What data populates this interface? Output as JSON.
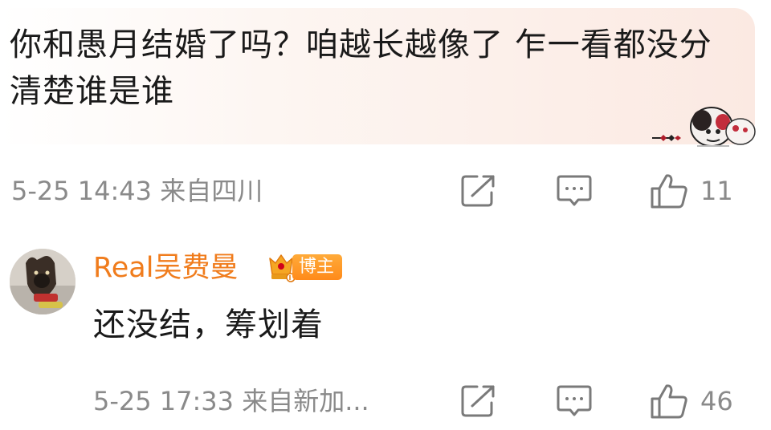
{
  "comment": {
    "text": "你和愚月结婚了吗？咱越长越像了 乍一看都没分清楚谁是谁",
    "time": "5-25 14:43",
    "location": "来自四川",
    "like_count": "11"
  },
  "reply": {
    "username": "Real吴费曼",
    "badge": "博主",
    "text": "还没结，筹划着",
    "time": "5-25 17:33",
    "location": "来自新加...",
    "like_count": "46"
  },
  "icons": {
    "share": "share-icon",
    "comment": "comment-icon",
    "like": "like-icon",
    "crown": "crown-icon"
  },
  "colors": {
    "username": "#f07c1c",
    "badge": "#ff8a1a",
    "meta_text": "#8a8a8a",
    "body_text": "#1a1a1a"
  }
}
